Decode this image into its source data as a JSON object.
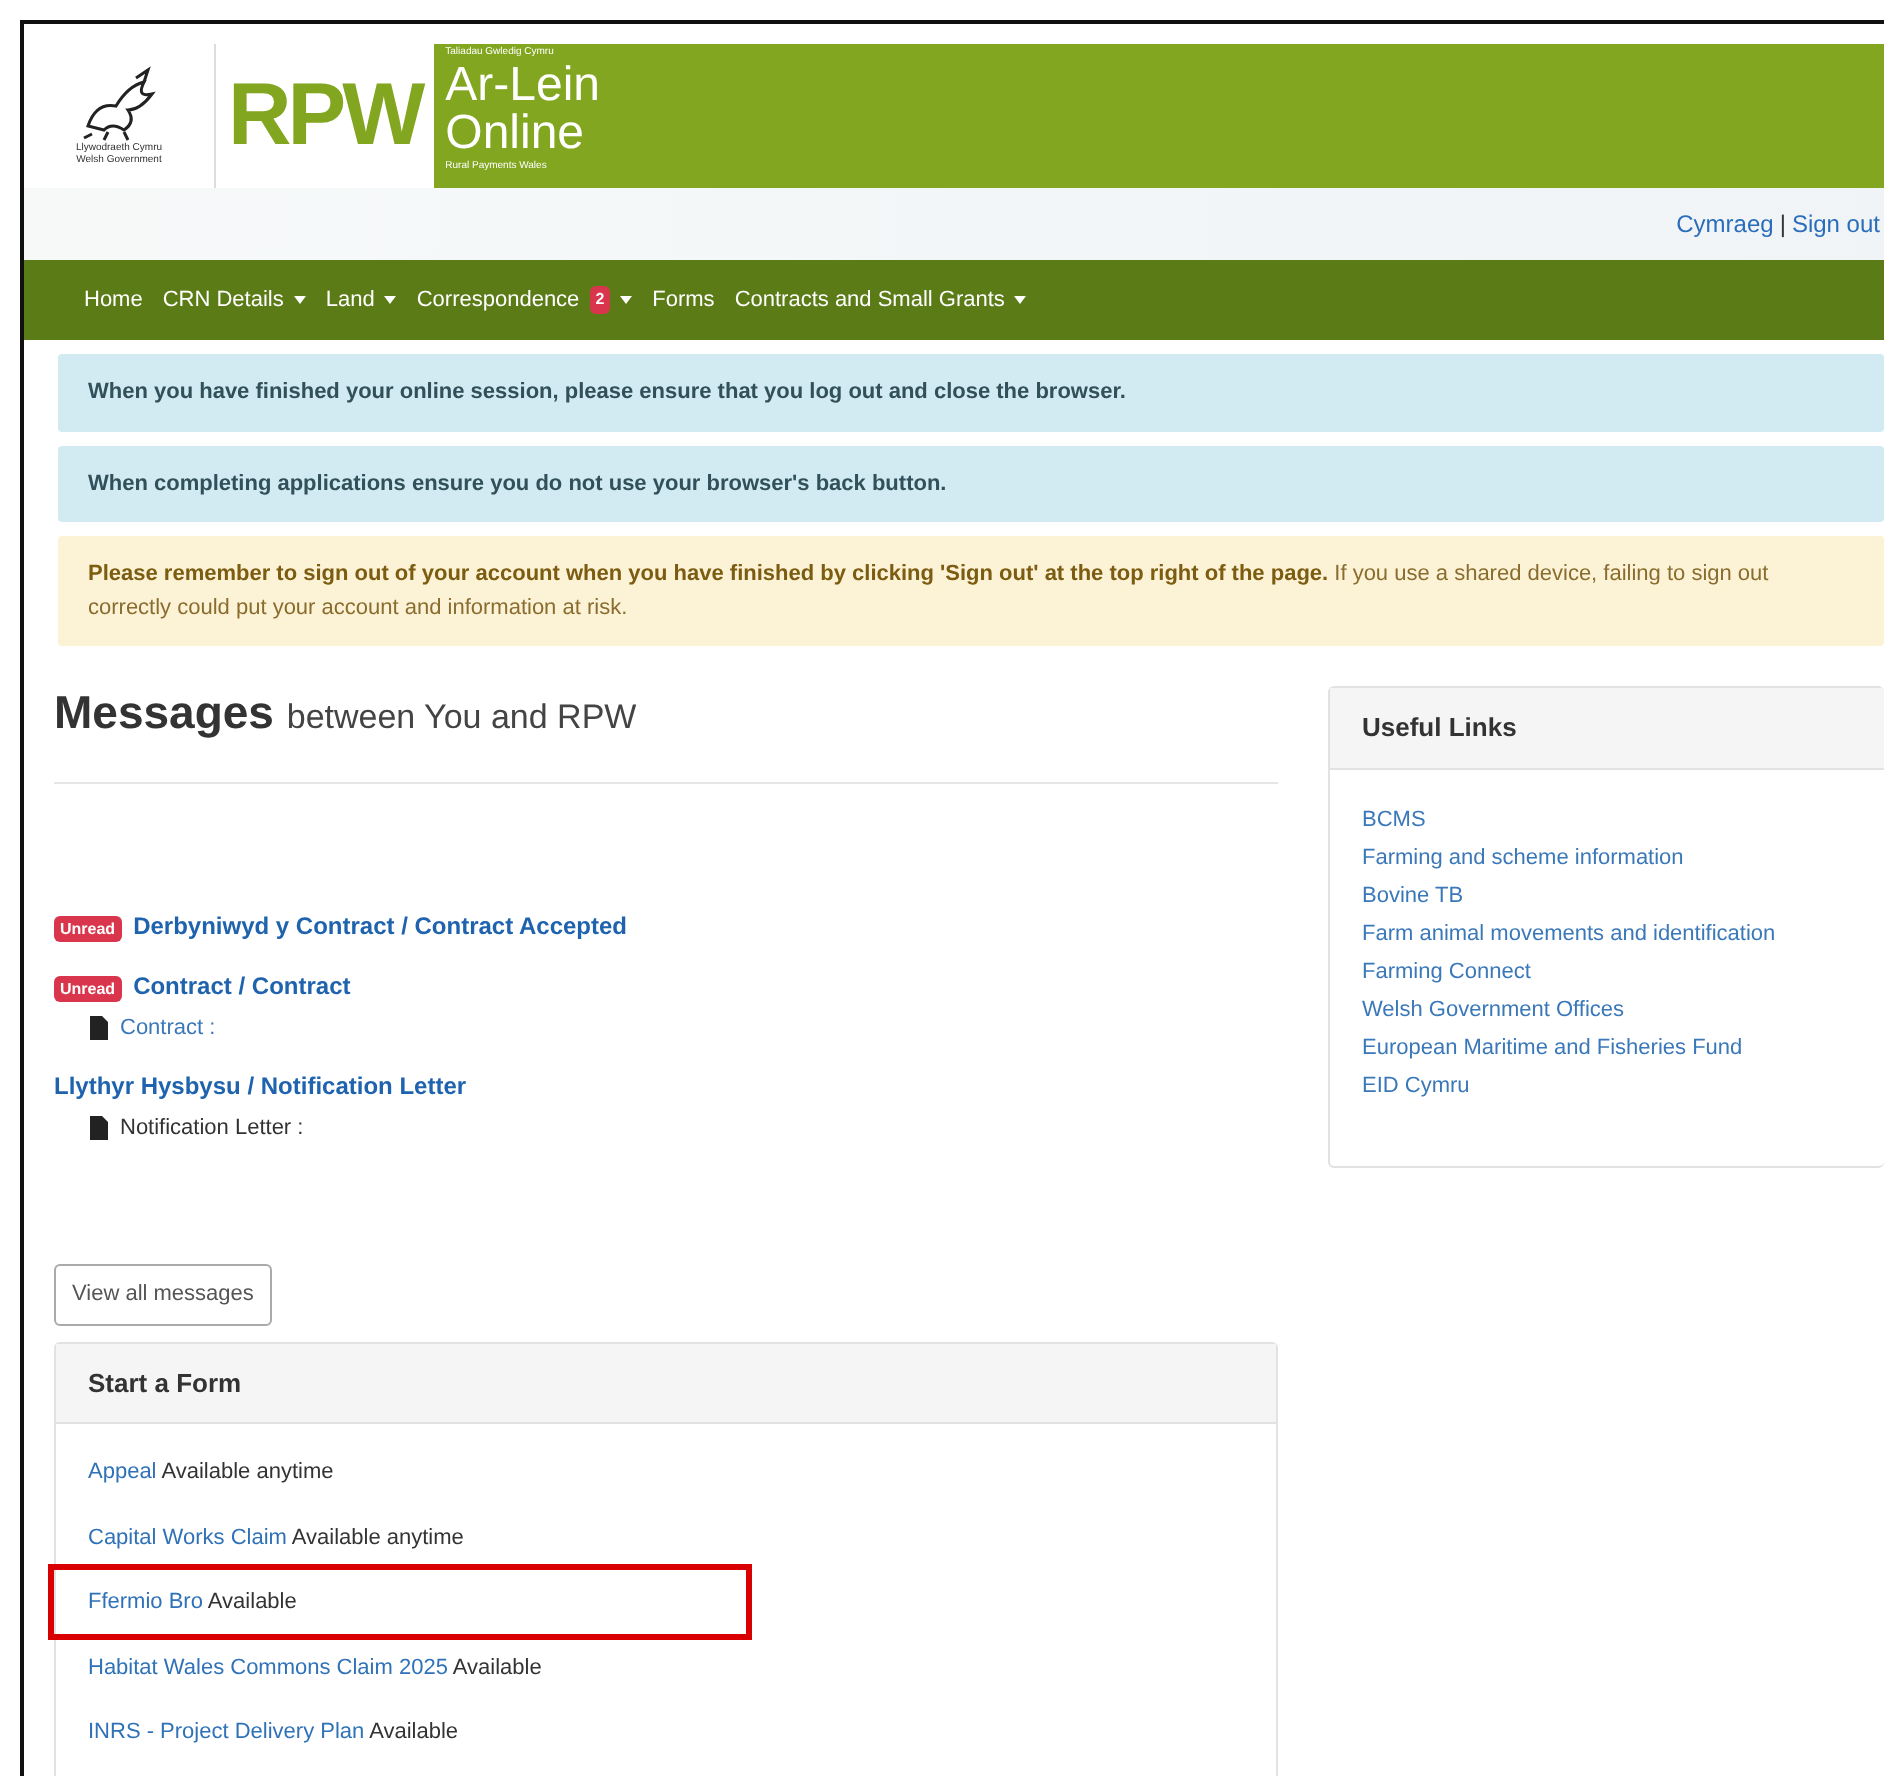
{
  "header": {
    "government": [
      "Llywodraeth Cymru",
      "Welsh Government"
    ],
    "brand": "RPW",
    "tagline": "Taliadau Gwledig Cymru",
    "title_welsh": "Ar-Lein",
    "title_english": "Online",
    "subtitle": "Rural Payments Wales"
  },
  "top_links": [
    "Cymraeg",
    "|",
    "Sign out"
  ],
  "nav": [
    {
      "label": "Home",
      "dropdown": false
    },
    {
      "label": "CRN Details",
      "dropdown": true
    },
    {
      "label": "Land",
      "dropdown": true
    },
    {
      "label": "Correspondence",
      "dropdown": true,
      "badge": "2"
    },
    {
      "label": "Forms",
      "dropdown": false
    },
    {
      "label": "Contracts and Small Grants",
      "dropdown": true
    }
  ],
  "alerts": [
    {
      "kind": "info",
      "text": "**When you have finished your online session, please ensure that you log out and close the browser.**"
    },
    {
      "kind": "info",
      "text": "**When completing applications ensure you do not use your browser's back button.**"
    },
    {
      "kind": "warning",
      "text": "**Please remember to sign out of your account when you have finished by clicking 'Sign out' at the top right of the page.** If you use a shared device, failing to sign out correctly could put your account and information at risk."
    }
  ],
  "messages": {
    "title": "Messages",
    "subtitle": "between You and RPW",
    "items": [
      {
        "badge": "Unread",
        "unread": true,
        "title": "Derbyniwyd y Contract / Contract Accepted"
      },
      {
        "badge": "Unread",
        "unread": true,
        "title": "Contract / Contract",
        "attachment": {
          "kind": "link",
          "text": "Contract :"
        }
      },
      {
        "unread": false,
        "title": "Llythyr Hysbysu / Notification Letter",
        "attachment": {
          "kind": "text",
          "text": "Notification Letter :"
        }
      }
    ],
    "button": "View all messages"
  },
  "start_form": {
    "title": "Start a Form",
    "items": [
      {
        "name": "Appeal",
        "availability": "Available anytime",
        "highlighted": false
      },
      {
        "name": "Capital Works Claim",
        "availability": "Available anytime",
        "highlighted": false
      },
      {
        "name": "Ffermio Bro",
        "availability": "Available",
        "highlighted": true
      },
      {
        "name": "Habitat Wales Commons Claim 2025",
        "availability": "Available",
        "highlighted": false
      },
      {
        "name": "INRS - Project Delivery Plan",
        "availability": "Available",
        "highlighted": false
      }
    ]
  },
  "useful_links": {
    "title": "Useful Links",
    "links": [
      "BCMS",
      "Farming and scheme information",
      "Bovine TB",
      "Farm animal movements and identification",
      "Farming Connect",
      "Welsh Government Offices",
      "European Maritime and Fisheries Fund",
      "EID Cymru"
    ]
  }
}
